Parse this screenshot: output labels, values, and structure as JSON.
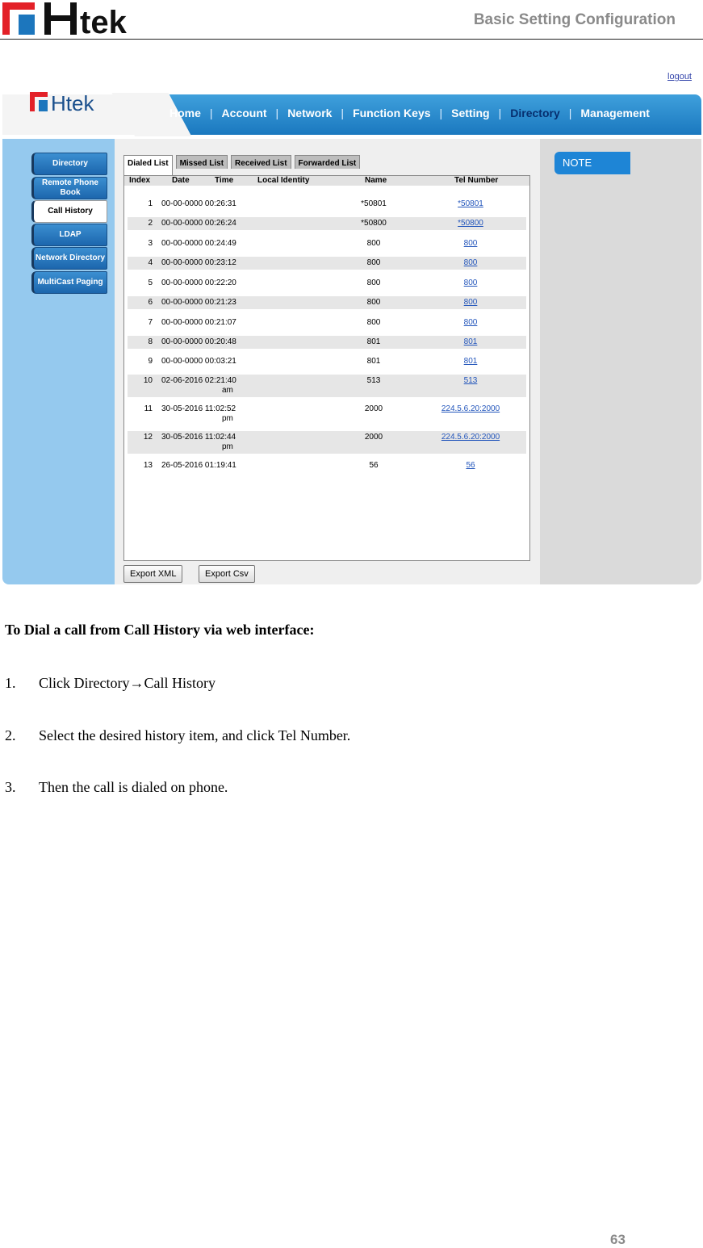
{
  "doc_header": {
    "title": "Basic Setting Configuration",
    "logo_text": "Htek"
  },
  "screenshot": {
    "logout": "logout",
    "logo_text": "Htek",
    "nav": [
      "Home",
      "Account",
      "Network",
      "Function Keys",
      "Setting",
      "Directory",
      "Management"
    ],
    "nav_active": "Directory",
    "sidebar": [
      "Directory",
      "Remote Phone Book",
      "Call History",
      "LDAP",
      "Network Directory",
      "MultiCast Paging"
    ],
    "sidebar_active": "Call History",
    "tabs": [
      "Dialed List",
      "Missed List",
      "Received List",
      "Forwarded List"
    ],
    "tab_active": "Dialed List",
    "columns": [
      "Index",
      "Date",
      "Time",
      "Local Identity",
      "Name",
      "Tel Number"
    ],
    "rows": [
      {
        "index": "1",
        "datetime": "00-00-0000 00:26:31",
        "name": "*50801",
        "tel": "*50801"
      },
      {
        "index": "2",
        "datetime": "00-00-0000 00:26:24",
        "name": "*50800",
        "tel": "*50800"
      },
      {
        "index": "3",
        "datetime": "00-00-0000 00:24:49",
        "name": "800",
        "tel": "800"
      },
      {
        "index": "4",
        "datetime": "00-00-0000 00:23:12",
        "name": "800",
        "tel": "800"
      },
      {
        "index": "5",
        "datetime": "00-00-0000 00:22:20",
        "name": "800",
        "tel": "800"
      },
      {
        "index": "6",
        "datetime": "00-00-0000 00:21:23",
        "name": "800",
        "tel": "800"
      },
      {
        "index": "7",
        "datetime": "00-00-0000 00:21:07",
        "name": "800",
        "tel": "800"
      },
      {
        "index": "8",
        "datetime": "00-00-0000 00:20:48",
        "name": "801",
        "tel": "801"
      },
      {
        "index": "9",
        "datetime": "00-00-0000 00:03:21",
        "name": "801",
        "tel": "801"
      },
      {
        "index": "10",
        "datetime": "02-06-2016 02:21:40",
        "datetime2": "am",
        "name": "513",
        "tel": "513"
      },
      {
        "index": "11",
        "datetime": "30-05-2016 11:02:52",
        "datetime2": "pm",
        "name": "2000",
        "tel": "224.5.6.20:2000"
      },
      {
        "index": "12",
        "datetime": "30-05-2016 11:02:44",
        "datetime2": "pm",
        "name": "2000",
        "tel": "224.5.6.20:2000"
      },
      {
        "index": "13",
        "datetime": "26-05-2016 01:19:41",
        "name": "56",
        "tel": "56"
      }
    ],
    "buttons": [
      "Export XML",
      "Export Csv"
    ],
    "note_label": "NOTE"
  },
  "body": {
    "heading": "To Dial a call from Call History via web interface:",
    "steps": [
      {
        "num": "1.",
        "text": "Click Directory→Call History"
      },
      {
        "num": "2.",
        "text": "Select the desired history item, and click Tel Number."
      },
      {
        "num": "3.",
        "text": "Then the call is dialed on phone."
      }
    ]
  },
  "page_number": "63",
  "colors": {
    "brand_red": "#e32128",
    "brand_blue": "#1c76bd",
    "nav_blue": "#2a8bd0",
    "link_blue": "#2255bb"
  }
}
